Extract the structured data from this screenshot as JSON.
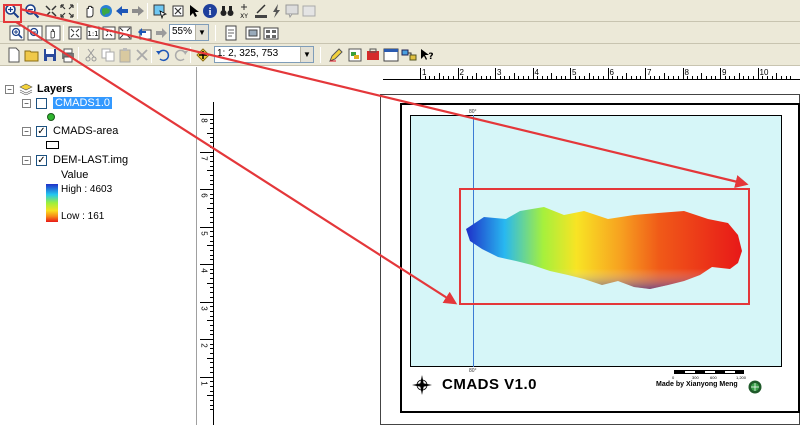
{
  "toolbar_row1": {
    "buttons": [
      "zoom-in",
      "zoom-out",
      "fixed-zoom-in",
      "fixed-zoom-out",
      "pan",
      "full-extent",
      "back",
      "forward",
      "select-features",
      "clear-selection",
      "select-elements",
      "identify",
      "find",
      "go-to-xy",
      "measure",
      "hyperlink",
      "html-popup",
      "time-slider"
    ]
  },
  "toolbar_row2": {
    "buttons": [
      "layout-zoom-in",
      "layout-zoom-out",
      "layout-pan",
      "zoom-whole-page",
      "zoom-100",
      "zoom-in-center",
      "zoom-out-center",
      "previous-extent",
      "next-extent"
    ],
    "zoom_percent": "55%",
    "after_zoom": [
      "toggle-draft",
      "focus-data-frame",
      "change-layout"
    ]
  },
  "toolbar_row3": {
    "buttons": [
      "new",
      "open",
      "save",
      "print",
      "cut",
      "copy",
      "paste",
      "delete",
      "undo",
      "redo",
      "add-data"
    ],
    "scale_value": "1: 2, 325, 753",
    "after_scale": [
      "editor",
      "catalog",
      "arctoolbox",
      "python",
      "model-builder",
      "whats-this"
    ]
  },
  "toc": {
    "root": "Layers",
    "layers": [
      {
        "name": "CMADS1.0",
        "selected": true,
        "checked": false
      },
      {
        "name": "CMADS-area",
        "selected": false,
        "checked": true
      },
      {
        "name": "DEM-LAST.img",
        "selected": false,
        "checked": true
      }
    ],
    "legend_value": "Value",
    "high_label": "High : 4603",
    "low_label": "Low : 161"
  },
  "ruler": {
    "h_labels": [
      "1",
      "2",
      "3",
      "4",
      "5",
      "6",
      "7",
      "8",
      "9",
      "10"
    ],
    "v_labels": [
      "8",
      "7",
      "6",
      "5",
      "4",
      "3",
      "2",
      "1"
    ]
  },
  "map": {
    "title": "CMADS V1.0",
    "author": "Made by Xianyong Meng",
    "grid_label_top": "80°",
    "grid_label_bottom": "80°",
    "scalebar_labels": [
      "0",
      "300",
      "600",
      "1,200"
    ]
  },
  "colors": {
    "toolbar": "#ece9d8",
    "highlight": "#3399ff",
    "annotation_red": "#e4373a",
    "map_background": "#d6f6f8"
  }
}
